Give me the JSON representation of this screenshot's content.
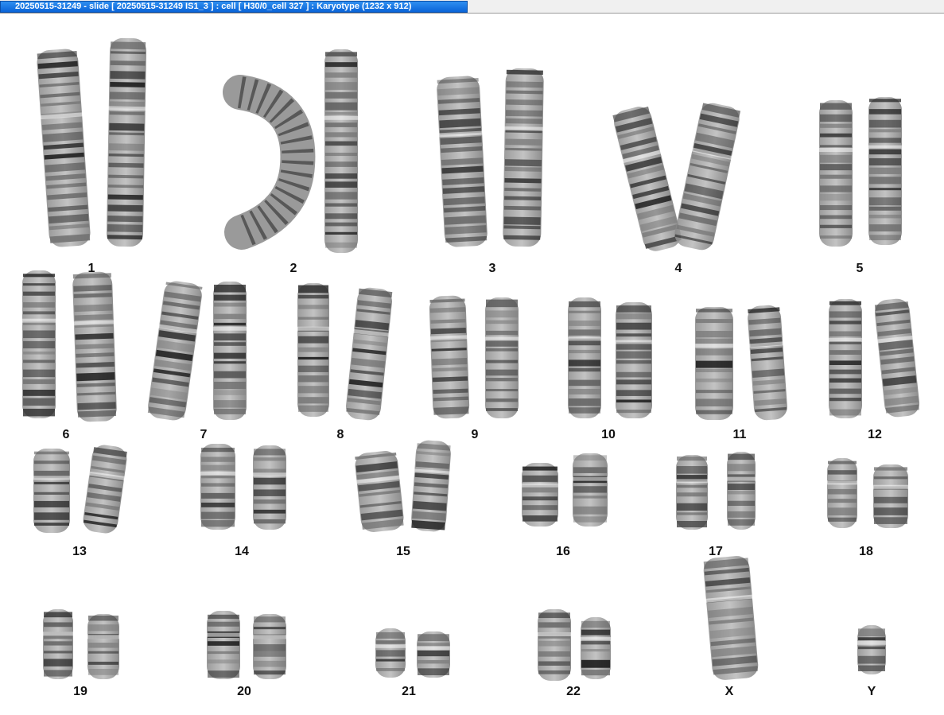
{
  "window": {
    "title": "20250515-31249 - slide [ 20250515-31249 IS1_3 ] : cell [ H30/0_cell 327 ] : Karyotype  (1232 x 912)"
  },
  "karyotype": {
    "labels": [
      "1",
      "2",
      "3",
      "4",
      "5",
      "6",
      "7",
      "8",
      "9",
      "10",
      "11",
      "12",
      "13",
      "14",
      "15",
      "16",
      "17",
      "18",
      "19",
      "20",
      "21",
      "22",
      "X",
      "Y"
    ]
  }
}
